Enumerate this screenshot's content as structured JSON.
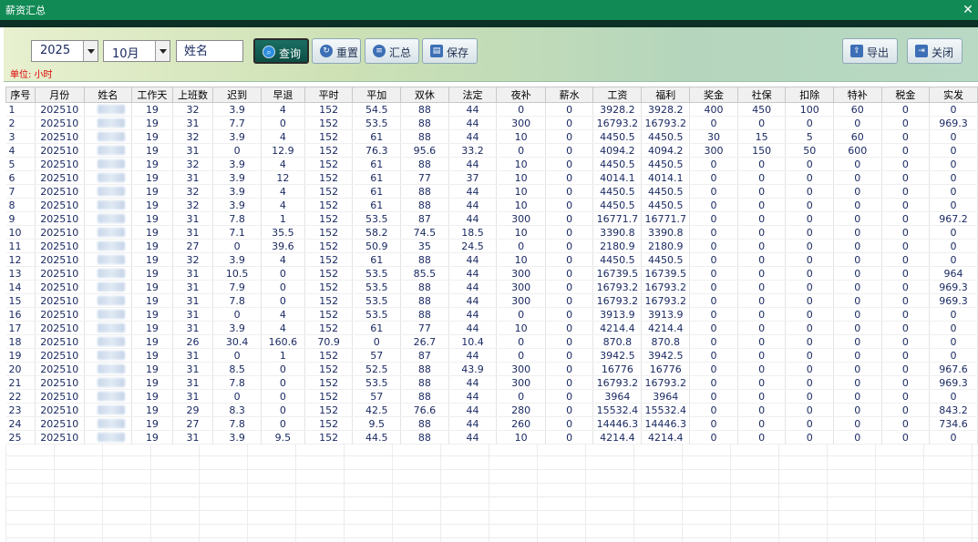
{
  "window": {
    "title": "薪资汇总",
    "close_glyph": "✕"
  },
  "toolbar": {
    "year": "2025",
    "month": "10月",
    "name_placeholder": "姓名",
    "query": "查询",
    "reset": "重置",
    "summary": "汇总",
    "save": "保存",
    "export": "导出",
    "close": "关闭",
    "unit": "单位: 小时"
  },
  "colors": {
    "titlebar": "#128a55",
    "unit_text": "#e00000",
    "cell_text": "#1b2a63"
  },
  "icons": {
    "query": "search-icon",
    "reset": "refresh-icon",
    "summary": "list-icon",
    "save": "save-icon",
    "export": "export-icon",
    "close": "exit-icon"
  },
  "table": {
    "columns": [
      "序号",
      "月份",
      "姓名",
      "工作天",
      "上班数",
      "迟到",
      "早退",
      "平时",
      "平加",
      "双休",
      "法定",
      "夜补",
      "薪水",
      "工资",
      "福利",
      "奖金",
      "社保",
      "扣除",
      "特补",
      "税金",
      "实发"
    ],
    "rows": [
      [
        "1",
        "202510",
        "",
        "19",
        "32",
        "3.9",
        "4",
        "152",
        "54.5",
        "88",
        "44",
        "0",
        "0",
        "3928.2",
        "3928.2",
        "400",
        "450",
        "100",
        "60",
        "0",
        "0"
      ],
      [
        "2",
        "202510",
        "",
        "19",
        "31",
        "7.7",
        "0",
        "152",
        "53.5",
        "88",
        "44",
        "300",
        "0",
        "16793.2",
        "16793.2",
        "0",
        "0",
        "0",
        "0",
        "0",
        "969.3"
      ],
      [
        "3",
        "202510",
        "",
        "19",
        "32",
        "3.9",
        "4",
        "152",
        "61",
        "88",
        "44",
        "10",
        "0",
        "4450.5",
        "4450.5",
        "30",
        "15",
        "5",
        "60",
        "0",
        "0"
      ],
      [
        "4",
        "202510",
        "",
        "19",
        "31",
        "0",
        "12.9",
        "152",
        "76.3",
        "95.6",
        "33.2",
        "0",
        "0",
        "4094.2",
        "4094.2",
        "300",
        "150",
        "50",
        "600",
        "0",
        "0"
      ],
      [
        "5",
        "202510",
        "",
        "19",
        "32",
        "3.9",
        "4",
        "152",
        "61",
        "88",
        "44",
        "10",
        "0",
        "4450.5",
        "4450.5",
        "0",
        "0",
        "0",
        "0",
        "0",
        "0"
      ],
      [
        "6",
        "202510",
        "",
        "19",
        "31",
        "3.9",
        "12",
        "152",
        "61",
        "77",
        "37",
        "10",
        "0",
        "4014.1",
        "4014.1",
        "0",
        "0",
        "0",
        "0",
        "0",
        "0"
      ],
      [
        "7",
        "202510",
        "",
        "19",
        "32",
        "3.9",
        "4",
        "152",
        "61",
        "88",
        "44",
        "10",
        "0",
        "4450.5",
        "4450.5",
        "0",
        "0",
        "0",
        "0",
        "0",
        "0"
      ],
      [
        "8",
        "202510",
        "",
        "19",
        "32",
        "3.9",
        "4",
        "152",
        "61",
        "88",
        "44",
        "10",
        "0",
        "4450.5",
        "4450.5",
        "0",
        "0",
        "0",
        "0",
        "0",
        "0"
      ],
      [
        "9",
        "202510",
        "",
        "19",
        "31",
        "7.8",
        "1",
        "152",
        "53.5",
        "87",
        "44",
        "300",
        "0",
        "16771.7",
        "16771.7",
        "0",
        "0",
        "0",
        "0",
        "0",
        "967.2"
      ],
      [
        "10",
        "202510",
        "",
        "19",
        "31",
        "7.1",
        "35.5",
        "152",
        "58.2",
        "74.5",
        "18.5",
        "10",
        "0",
        "3390.8",
        "3390.8",
        "0",
        "0",
        "0",
        "0",
        "0",
        "0"
      ],
      [
        "11",
        "202510",
        "",
        "19",
        "27",
        "0",
        "39.6",
        "152",
        "50.9",
        "35",
        "24.5",
        "0",
        "0",
        "2180.9",
        "2180.9",
        "0",
        "0",
        "0",
        "0",
        "0",
        "0"
      ],
      [
        "12",
        "202510",
        "",
        "19",
        "32",
        "3.9",
        "4",
        "152",
        "61",
        "88",
        "44",
        "10",
        "0",
        "4450.5",
        "4450.5",
        "0",
        "0",
        "0",
        "0",
        "0",
        "0"
      ],
      [
        "13",
        "202510",
        "",
        "19",
        "31",
        "10.5",
        "0",
        "152",
        "53.5",
        "85.5",
        "44",
        "300",
        "0",
        "16739.5",
        "16739.5",
        "0",
        "0",
        "0",
        "0",
        "0",
        "964"
      ],
      [
        "14",
        "202510",
        "",
        "19",
        "31",
        "7.9",
        "0",
        "152",
        "53.5",
        "88",
        "44",
        "300",
        "0",
        "16793.2",
        "16793.2",
        "0",
        "0",
        "0",
        "0",
        "0",
        "969.3"
      ],
      [
        "15",
        "202510",
        "",
        "19",
        "31",
        "7.8",
        "0",
        "152",
        "53.5",
        "88",
        "44",
        "300",
        "0",
        "16793.2",
        "16793.2",
        "0",
        "0",
        "0",
        "0",
        "0",
        "969.3"
      ],
      [
        "16",
        "202510",
        "",
        "19",
        "31",
        "0",
        "4",
        "152",
        "53.5",
        "88",
        "44",
        "0",
        "0",
        "3913.9",
        "3913.9",
        "0",
        "0",
        "0",
        "0",
        "0",
        "0"
      ],
      [
        "17",
        "202510",
        "",
        "19",
        "31",
        "3.9",
        "4",
        "152",
        "61",
        "77",
        "44",
        "10",
        "0",
        "4214.4",
        "4214.4",
        "0",
        "0",
        "0",
        "0",
        "0",
        "0"
      ],
      [
        "18",
        "202510",
        "",
        "19",
        "26",
        "30.4",
        "160.6",
        "70.9",
        "0",
        "26.7",
        "10.4",
        "0",
        "0",
        "870.8",
        "870.8",
        "0",
        "0",
        "0",
        "0",
        "0",
        "0"
      ],
      [
        "19",
        "202510",
        "",
        "19",
        "31",
        "0",
        "1",
        "152",
        "57",
        "87",
        "44",
        "0",
        "0",
        "3942.5",
        "3942.5",
        "0",
        "0",
        "0",
        "0",
        "0",
        "0"
      ],
      [
        "20",
        "202510",
        "",
        "19",
        "31",
        "8.5",
        "0",
        "152",
        "52.5",
        "88",
        "43.9",
        "300",
        "0",
        "16776",
        "16776",
        "0",
        "0",
        "0",
        "0",
        "0",
        "967.6"
      ],
      [
        "21",
        "202510",
        "",
        "19",
        "31",
        "7.8",
        "0",
        "152",
        "53.5",
        "88",
        "44",
        "300",
        "0",
        "16793.2",
        "16793.2",
        "0",
        "0",
        "0",
        "0",
        "0",
        "969.3"
      ],
      [
        "22",
        "202510",
        "",
        "19",
        "31",
        "0",
        "0",
        "152",
        "57",
        "88",
        "44",
        "0",
        "0",
        "3964",
        "3964",
        "0",
        "0",
        "0",
        "0",
        "0",
        "0"
      ],
      [
        "23",
        "202510",
        "",
        "19",
        "29",
        "8.3",
        "0",
        "152",
        "42.5",
        "76.6",
        "44",
        "280",
        "0",
        "15532.4",
        "15532.4",
        "0",
        "0",
        "0",
        "0",
        "0",
        "843.2"
      ],
      [
        "24",
        "202510",
        "",
        "19",
        "27",
        "7.8",
        "0",
        "152",
        "9.5",
        "88",
        "44",
        "260",
        "0",
        "14446.3",
        "14446.3",
        "0",
        "0",
        "0",
        "0",
        "0",
        "734.6"
      ],
      [
        "25",
        "202510",
        "",
        "19",
        "31",
        "3.9",
        "9.5",
        "152",
        "44.5",
        "88",
        "44",
        "10",
        "0",
        "4214.4",
        "4214.4",
        "0",
        "0",
        "0",
        "0",
        "0",
        "0"
      ]
    ]
  }
}
